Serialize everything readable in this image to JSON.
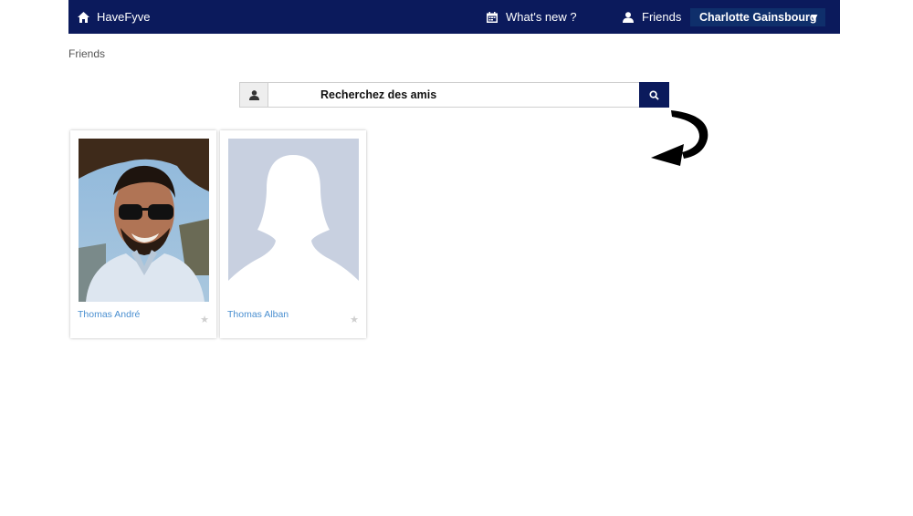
{
  "navbar": {
    "brand": "HaveFyve",
    "brand_icon": "home-icon",
    "whats_new": "What's new ?",
    "whats_new_icon": "calendar-icon",
    "friends": "Friends",
    "friends_icon": "user-icon",
    "user_name": "Charlotte Gainsbourg",
    "caret": "▼"
  },
  "breadcrumb": "Friends",
  "search": {
    "placeholder": "Recherchez des amis",
    "addon_icon": "user-icon",
    "button_icon": "search-icon"
  },
  "friends": [
    {
      "name": "Thomas André",
      "photo": "profile-photo",
      "favorite": "★"
    },
    {
      "name": "Thomas Alban",
      "photo": "default-avatar",
      "favorite": "★"
    }
  ],
  "colors": {
    "navbar": "#0b1a5c",
    "user_chip": "#0f2f6b",
    "link": "#4a8fd0",
    "placeholder_avatar": "#c8d0e0"
  }
}
